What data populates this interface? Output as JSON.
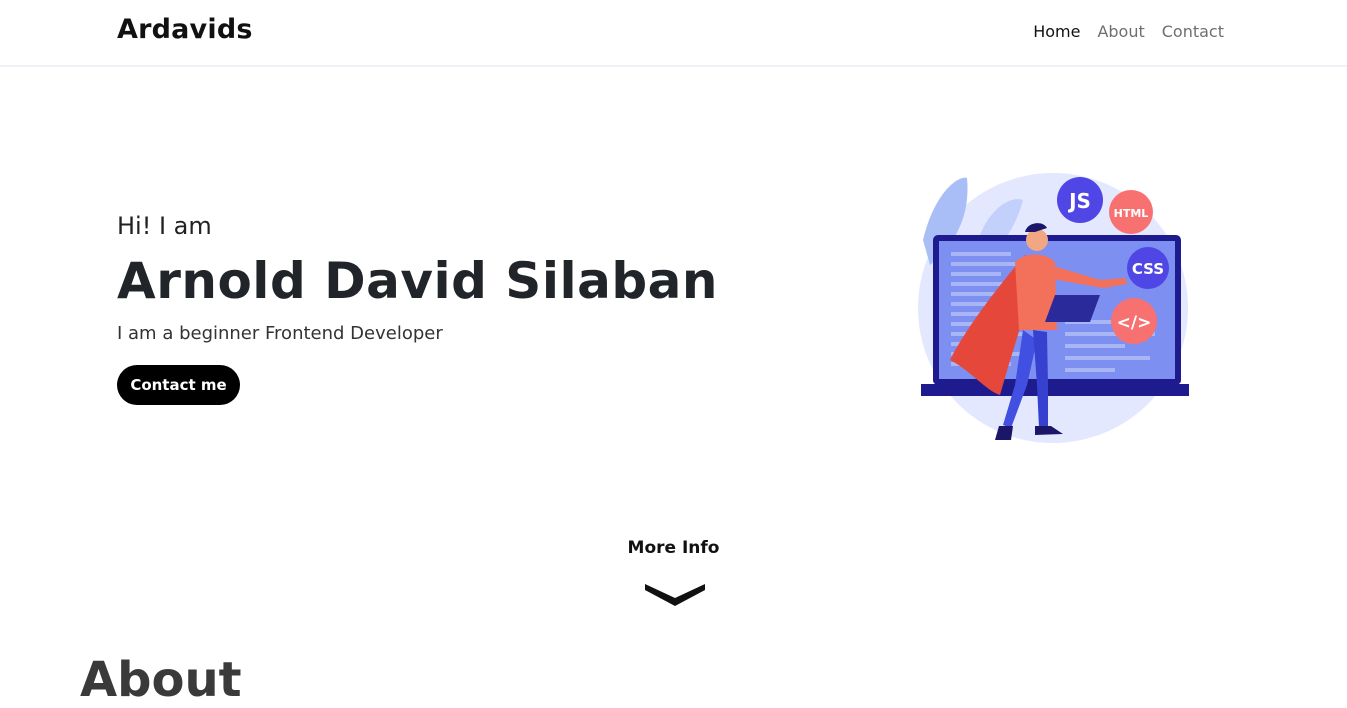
{
  "navbar": {
    "brand": "Ardavids",
    "links": [
      {
        "label": "Home",
        "active": true
      },
      {
        "label": "About",
        "active": false
      },
      {
        "label": "Contact",
        "active": false
      }
    ]
  },
  "hero": {
    "greeting": "Hi! I am",
    "name": "Arnold David Silaban",
    "subtitle": "I am a beginner Frontend Developer",
    "cta_label": "Contact me",
    "illustration_badges": {
      "js": "JS",
      "html": "HTML",
      "css": "CSS",
      "code": "</>"
    }
  },
  "more_info": {
    "label": "More Info",
    "icon": "chevron-down-icon"
  },
  "about_section": {
    "heading": "About"
  },
  "colors": {
    "brand_text": "#111111",
    "button_bg": "#000000",
    "illustration_purple": "#4f46e5",
    "illustration_coral": "#f87171",
    "illustration_bg": "#e0e7ff"
  }
}
